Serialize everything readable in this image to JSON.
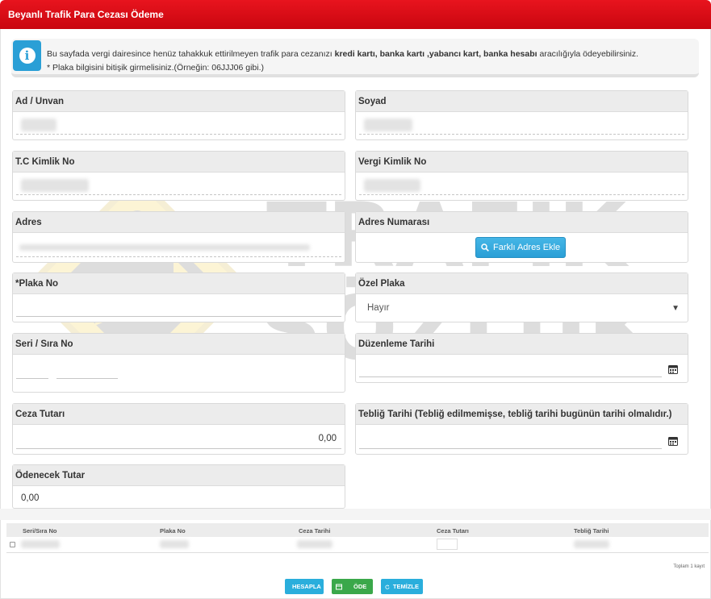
{
  "header": {
    "title": "Beyanlı Trafik Para Cezası Ödeme"
  },
  "info": {
    "icon": "info-icon",
    "line1_pre": "Bu sayfada vergi dairesince henüz tahakkuk ettirilmeyen trafik para cezanızı ",
    "line1_bold1": "kredi kartı, banka kartı ,yabancı kart, banka hesabı",
    "line1_post": " aracılığıyla ödeyebilirsiniz.",
    "line2": "* Plaka bilgisini bitişik girmelisiniz.(Örneğin: 06JJJ06 gibi.)"
  },
  "watermark": {
    "line1": "TRAFİK",
    "line2": "SÖZLÜK"
  },
  "form": {
    "ad_label": "Ad / Unvan",
    "soyad_label": "Soyad",
    "tc_label": "T.C Kimlik No",
    "vergi_label": "Vergi Kimlik No",
    "adres_label": "Adres",
    "adres_no_label": "Adres Numarası",
    "farkli_adres_button": "Farklı Adres Ekle",
    "plaka_label": "*Plaka No",
    "ozel_plaka_label": "Özel Plaka",
    "ozel_plaka_value": "Hayır",
    "seri_label": "Seri / Sıra No",
    "duzenleme_label": "Düzenleme Tarihi",
    "ceza_label": "Ceza Tutarı",
    "ceza_value": "0,00",
    "teblig_label": "Tebliğ Tarihi (Tebliğ edilmemişse, tebliğ tarihi bugünün tarihi olmalıdır.)",
    "odenecek_label": "Ödenecek Tutar",
    "odenecek_value": "0,00"
  },
  "table": {
    "columns": [
      "Seri/Sıra No",
      "Plaka No",
      "Ceza Tarihi",
      "Ceza Tutarı",
      "Tebliğ Tarihi"
    ],
    "count_text": "Toplam 1 kayıt"
  },
  "actions": {
    "hesapla": "HESAPLA",
    "ode": "ÖDE",
    "temizle": "TEMİZLE"
  },
  "colors": {
    "header": "#d10b14",
    "accent": "#2a9fd6",
    "success": "#3aa84a"
  }
}
